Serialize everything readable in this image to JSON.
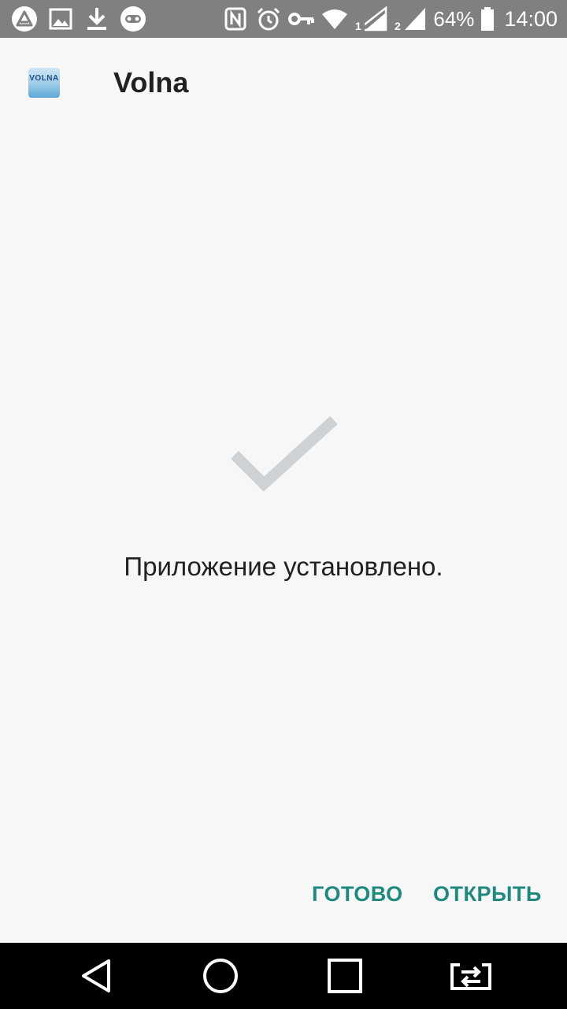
{
  "status_bar": {
    "battery_percent": "64%",
    "time": "14:00",
    "sim1_label": "1",
    "sim2_label": "2",
    "icons_left": [
      "app-alert-icon",
      "image-icon",
      "download-icon",
      "game-controller-icon"
    ],
    "icons_right": [
      "nfc-icon",
      "alarm-icon",
      "vpn-key-icon",
      "wifi-icon",
      "signal-sim1-icon",
      "signal-sim2-icon",
      "battery-icon"
    ]
  },
  "app": {
    "name": "Volna",
    "icon_text": "VOLNA"
  },
  "content": {
    "message": "Приложение установлено.",
    "check_color": "#cfd2d4"
  },
  "actions": {
    "done_label": "ГОТОВО",
    "open_label": "ОТКРЫТЬ",
    "accent_color": "#1e8a7e"
  },
  "navigation": {
    "items": [
      "back-icon",
      "home-icon",
      "recents-icon",
      "switch-apps-icon"
    ]
  }
}
